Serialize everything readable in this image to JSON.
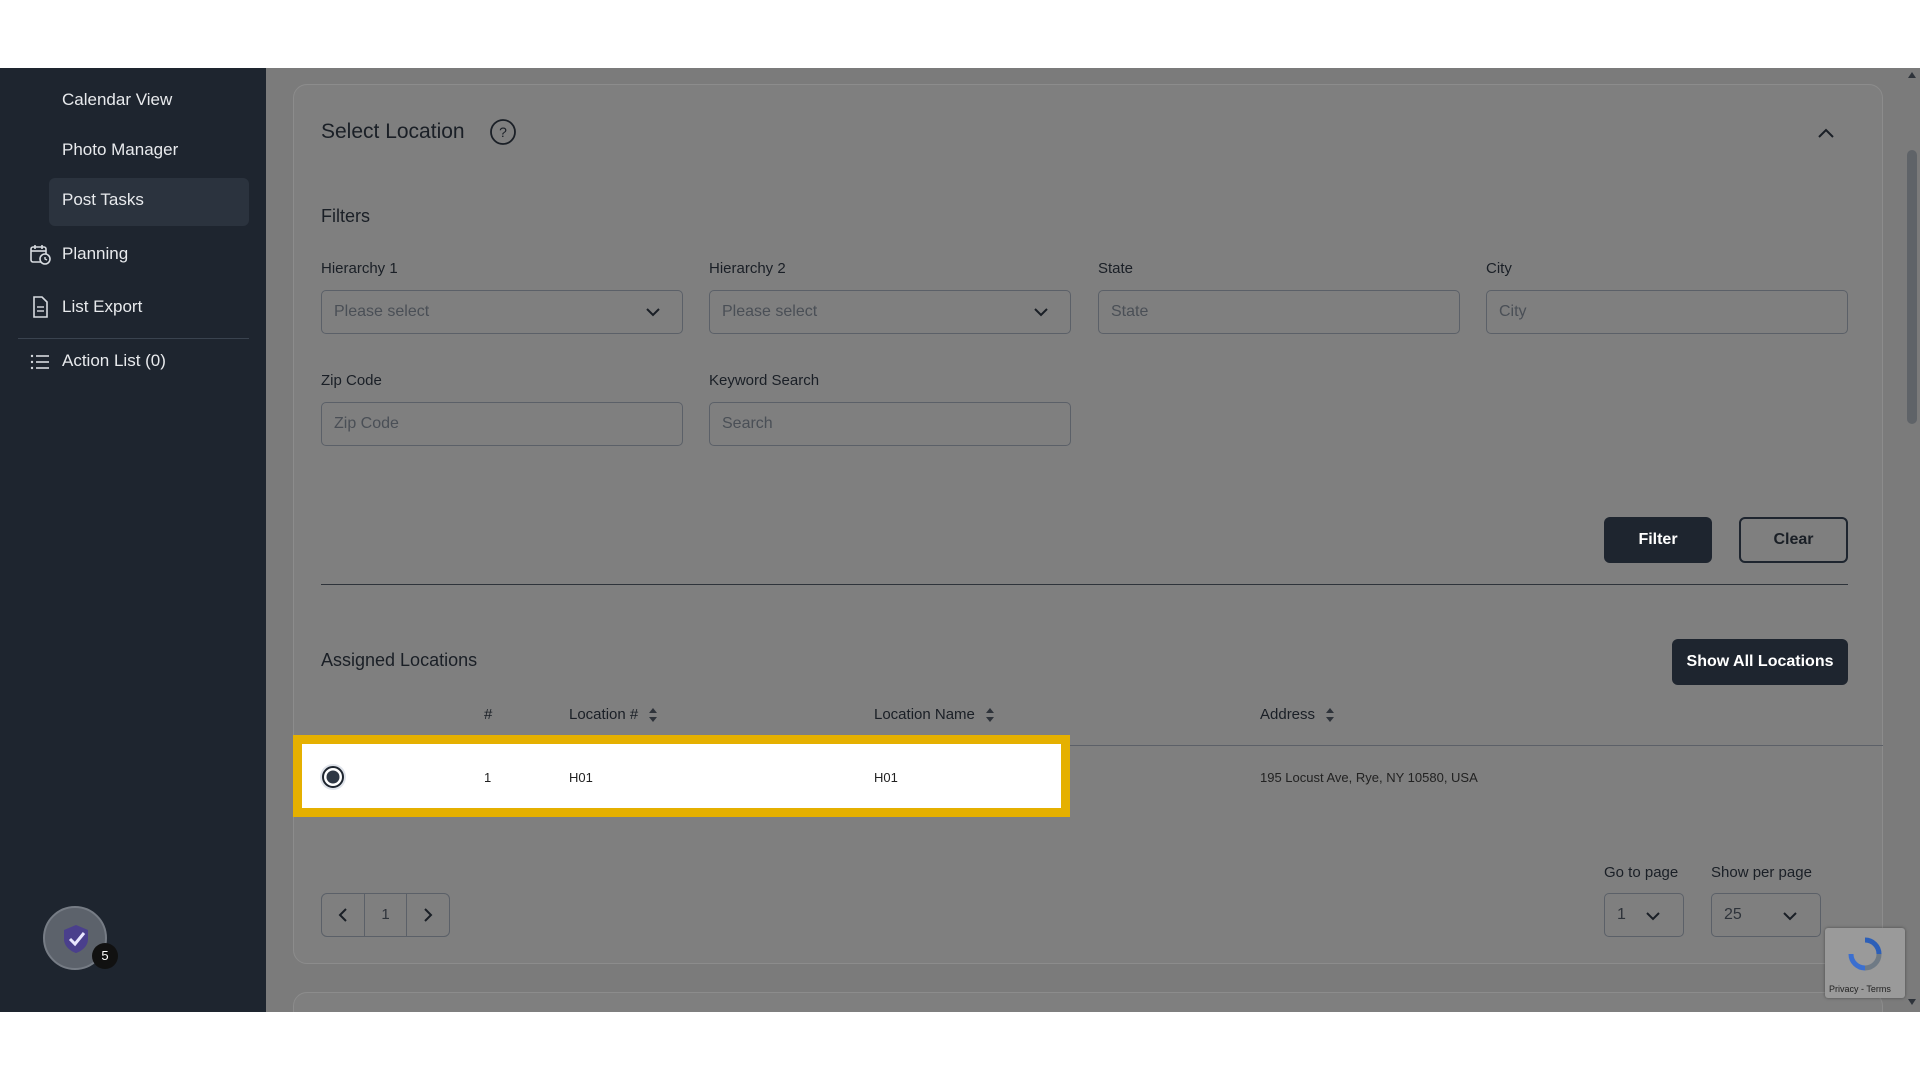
{
  "sidebar": {
    "sub_items": [
      {
        "label": "Calendar View"
      },
      {
        "label": "Photo Manager"
      },
      {
        "label": "Post Tasks"
      }
    ],
    "items": [
      {
        "label": "Planning",
        "icon": "calendar-clock-icon"
      },
      {
        "label": "List Export",
        "icon": "document-icon"
      },
      {
        "label": "Action List (0)",
        "icon": "list-icon"
      }
    ],
    "fab_badge": "5"
  },
  "panel": {
    "title": "Select Location",
    "filters_label": "Filters",
    "fields": {
      "hierarchy1": {
        "label": "Hierarchy 1",
        "placeholder": "Please select"
      },
      "hierarchy2": {
        "label": "Hierarchy 2",
        "placeholder": "Please select"
      },
      "state": {
        "label": "State",
        "placeholder": "State"
      },
      "city": {
        "label": "City",
        "placeholder": "City"
      },
      "zip": {
        "label": "Zip Code",
        "placeholder": "Zip Code"
      },
      "keyword": {
        "label": "Keyword Search",
        "placeholder": "Search"
      }
    },
    "filter_button": "Filter",
    "clear_button": "Clear"
  },
  "assigned": {
    "title": "Assigned Locations",
    "show_all_button": "Show All Locations",
    "columns": [
      "#",
      "Location #",
      "Location Name",
      "Address"
    ],
    "rows": [
      {
        "index": "1",
        "location_num": "H01",
        "location_name": "H01",
        "address": "195 Locust Ave, Rye, NY 10580, USA"
      }
    ]
  },
  "pagination": {
    "current_page": "1",
    "go_to_label": "Go to page",
    "go_to_value": "1",
    "per_page_label": "Show per page",
    "per_page_value": "25"
  },
  "recaptcha": {
    "text": "Privacy - Terms"
  },
  "colors": {
    "sidebar_bg": "#1e252f",
    "highlight": "#e5b000",
    "overlay": "#7f7f7f"
  }
}
